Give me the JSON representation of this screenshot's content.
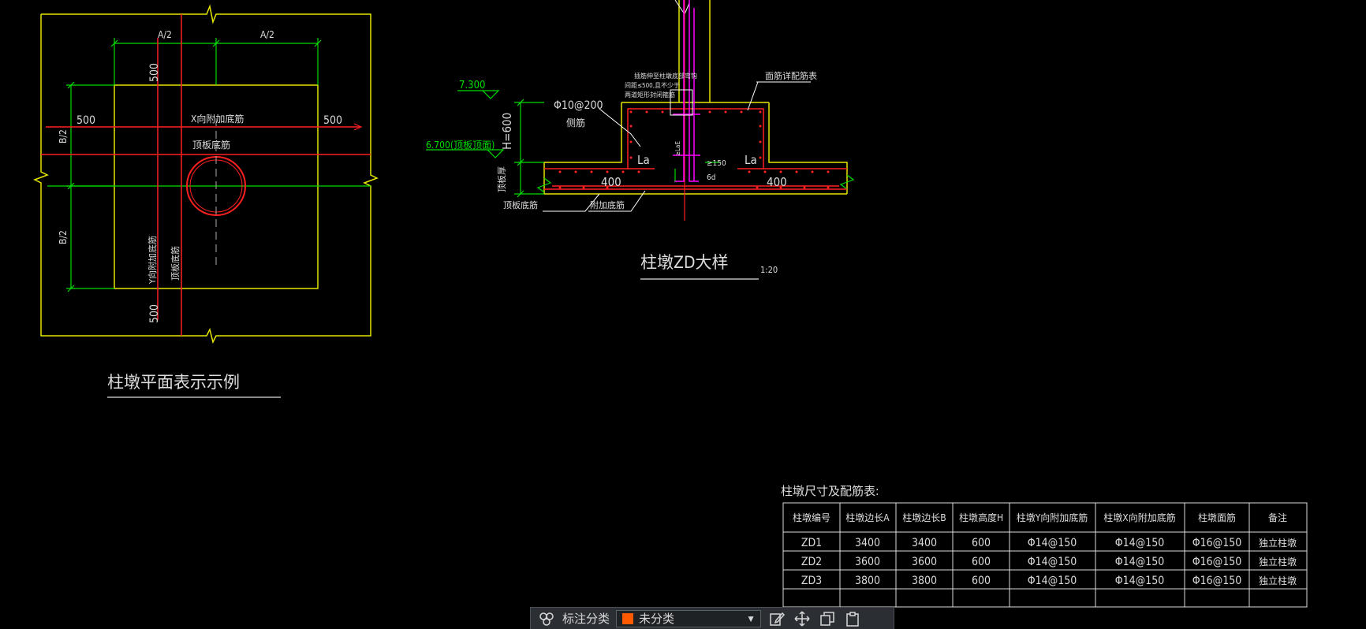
{
  "plan_view": {
    "dim_a_half": "A/2",
    "dim_b_half": "B/2",
    "dim_500": "500",
    "x_bar_label": "X向附加底筋",
    "top_bar_label": "顶板底筋",
    "y_bar_label": "Y向附加底筋",
    "y_top_bar_label": "顶板底筋",
    "title": "柱墩平面表示示例"
  },
  "section_view": {
    "elev_top": "7.300",
    "elev_bottom": "6.700(顶板顶面)",
    "height_label": "H=600",
    "side_bar": "Φ10@200",
    "side_bar_note": "侧筋",
    "la_label": "La",
    "dim_400": "400",
    "dim_150": "≥150",
    "dim_6d": "6d",
    "dim_lae": "≥LaE",
    "slab_thick": "顶板厚",
    "top_rebar_note": "面筋详配筋表",
    "column_note_1": "插筋伸至柱墩底部弯钩",
    "column_note_2": "间距≤500,且不少于",
    "column_note_3": "两道矩形封闭箍筋",
    "slab_bottom": "顶板底筋",
    "extra_bottom": "附加底筋",
    "title": "柱墩ZD大样",
    "scale": "1:20"
  },
  "table": {
    "caption": "柱墩尺寸及配筋表:",
    "headers": [
      "柱墩编号",
      "柱墩边长A",
      "柱墩边长B",
      "柱墩高度H",
      "柱墩Y向附加底筋",
      "柱墩X向附加底筋",
      "柱墩面筋",
      "备注"
    ],
    "rows": [
      [
        "ZD1",
        "3400",
        "3400",
        "600",
        "Φ14@150",
        "Φ14@150",
        "Φ16@150",
        "独立柱墩"
      ],
      [
        "ZD2",
        "3600",
        "3600",
        "600",
        "Φ14@150",
        "Φ14@150",
        "Φ16@150",
        "独立柱墩"
      ],
      [
        "ZD3",
        "3800",
        "3800",
        "600",
        "Φ14@150",
        "Φ14@150",
        "Φ16@150",
        "独立柱墩"
      ]
    ]
  },
  "toolbar": {
    "category_label": "标注分类",
    "category_value": "未分类",
    "swatch_color": "#ff5a00"
  }
}
